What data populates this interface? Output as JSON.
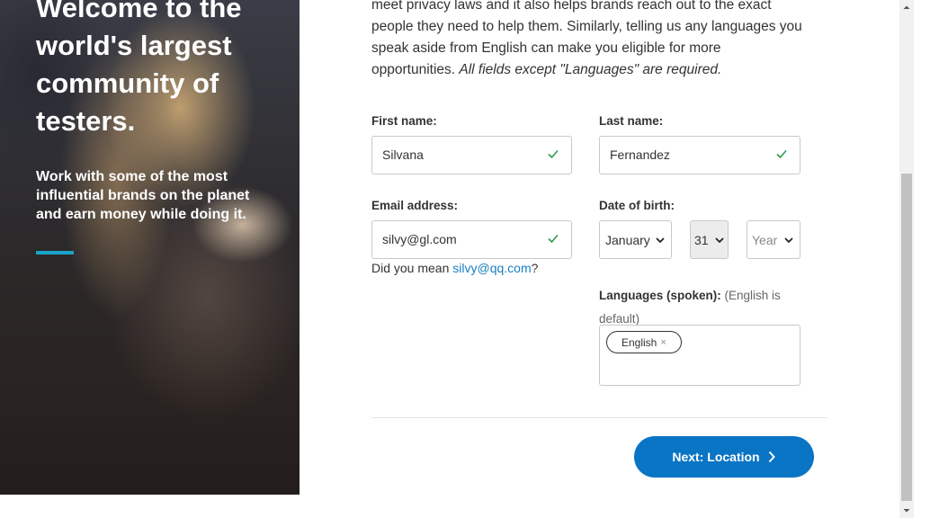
{
  "hero": {
    "title": "Welcome to the world's largest community of testers.",
    "subtitle": "Work with some of the most influential brands on the planet and earn money while doing it."
  },
  "intro": {
    "line1": "meet privacy laws and it also helps brands reach out to the exact",
    "line2": "people they need to help them. Similarly, telling us any languages you",
    "line3": "speak aside from English can make you eligible for more",
    "line4": "opportunities. ",
    "line4_em": "All fields except \"Languages\" are required."
  },
  "form": {
    "first_name_label": "First name:",
    "first_name_value": "Silvana",
    "last_name_label": "Last name:",
    "last_name_value": "Fernandez",
    "email_label": "Email address:",
    "email_value": "silvy@gl.com",
    "email_hint_prefix": "Did you mean ",
    "email_hint_link": "silvy@qq.com",
    "email_hint_suffix": "?",
    "dob_label": "Date of birth:",
    "dob_month": "January",
    "dob_day": "31",
    "dob_year_placeholder": "Year",
    "languages_label": "Languages (spoken):",
    "languages_note": "(English is default)",
    "languages": [
      "English"
    ],
    "tag_remove": "×",
    "next_button": "Next: Location"
  },
  "colors": {
    "accent": "#0a74c5",
    "link": "#1a7fc1",
    "hero_bar": "#1aa3c9",
    "valid_check": "#2e9b4c"
  },
  "icons": {
    "valid": "check-icon",
    "select": "chevron-down-icon",
    "next": "chevron-right-icon"
  }
}
